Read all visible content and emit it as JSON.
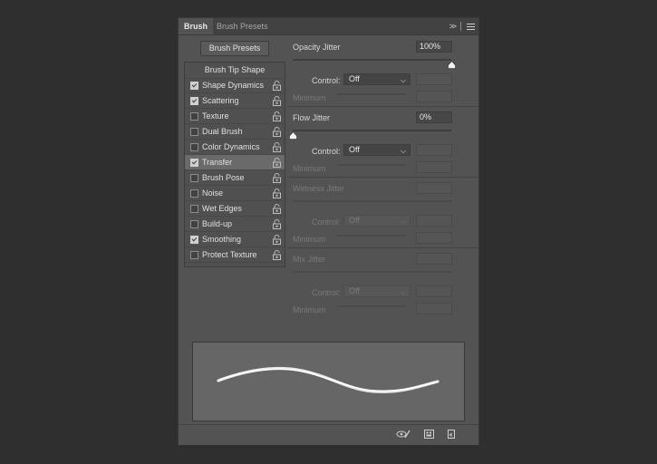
{
  "tabs": {
    "active": "Brush",
    "inactive": "Brush Presets"
  },
  "tab_icons": {
    "collapse": "double-chevron-icon",
    "menu": "hamburger-menu-icon"
  },
  "brush_presets_button": "Brush Presets",
  "options_header": "Brush Tip Shape",
  "options": [
    {
      "label": "Shape Dynamics",
      "checked": true
    },
    {
      "label": "Scattering",
      "checked": true
    },
    {
      "label": "Texture",
      "checked": false
    },
    {
      "label": "Dual Brush",
      "checked": false
    },
    {
      "label": "Color Dynamics",
      "checked": false
    },
    {
      "label": "Transfer",
      "checked": true,
      "selected": true
    },
    {
      "label": "Brush Pose",
      "checked": false
    },
    {
      "label": "Noise",
      "checked": false
    },
    {
      "label": "Wet Edges",
      "checked": false
    },
    {
      "label": "Build-up",
      "checked": false
    },
    {
      "label": "Smoothing",
      "checked": true
    },
    {
      "label": "Protect Texture",
      "checked": false
    }
  ],
  "transfer": {
    "opacity_jitter": {
      "label": "Opacity Jitter",
      "value": "100%",
      "level": 1.0
    },
    "opacity_control": {
      "label": "Control:",
      "value": "Off"
    },
    "opacity_minimum": {
      "label": "Minimum"
    },
    "flow_jitter": {
      "label": "Flow Jitter",
      "value": "0%",
      "level": 0.0
    },
    "flow_control": {
      "label": "Control:",
      "value": "Off"
    },
    "flow_minimum": {
      "label": "Minimum"
    },
    "wetness_jitter": {
      "label": "Wetness Jitter"
    },
    "wetness_control": {
      "label": "Control:",
      "value": "Off"
    },
    "wetness_minimum": {
      "label": "Minimum"
    },
    "mix_jitter": {
      "label": "Mix Jitter"
    },
    "mix_control": {
      "label": "Control:",
      "value": "Off"
    },
    "mix_minimum": {
      "label": "Minimum"
    }
  },
  "bottom_icons": [
    "eye-brush-icon",
    "grid-icon",
    "new-preset-icon"
  ],
  "colors": {
    "panel": "#535353",
    "background": "#2f2f2f",
    "preview": "#666666"
  }
}
